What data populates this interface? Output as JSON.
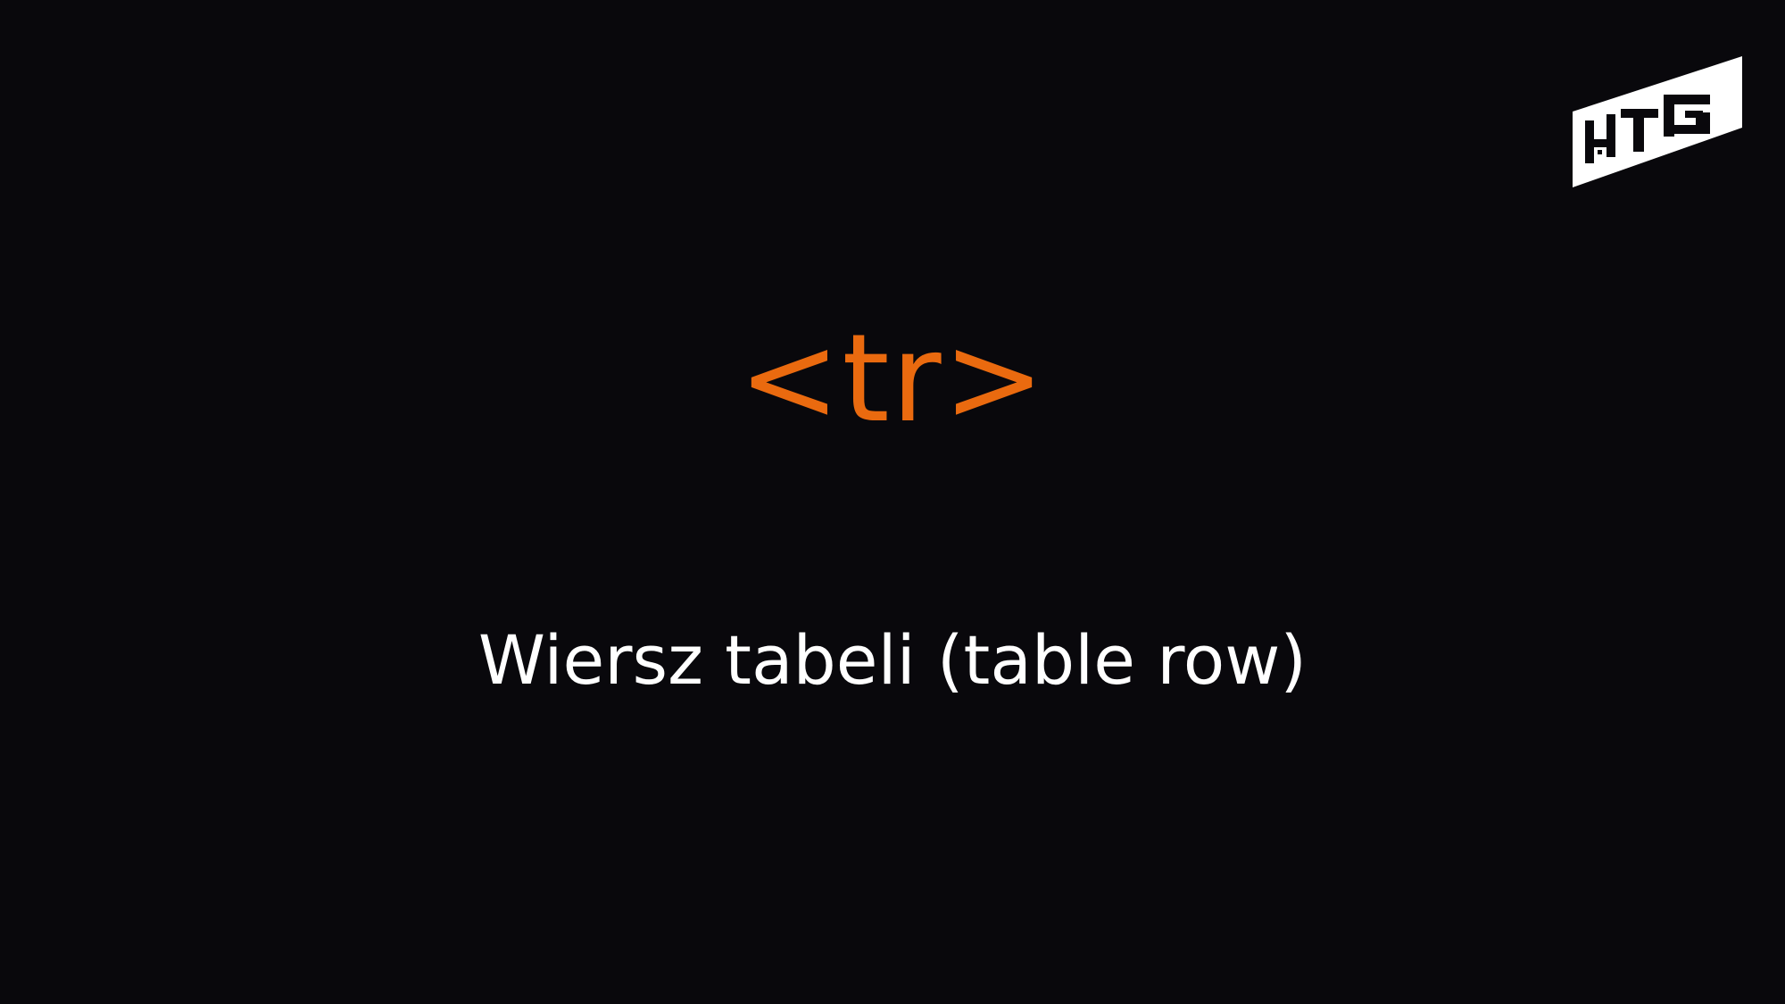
{
  "slide": {
    "tag": "<tr>",
    "description": "Wiersz tabeli (table row)"
  },
  "logo": {
    "icon": "brand-logo-icon",
    "lettering": "HTG"
  },
  "colors": {
    "background": "#09080c",
    "accent": "#ea6a0f",
    "text": "#ffffff"
  }
}
